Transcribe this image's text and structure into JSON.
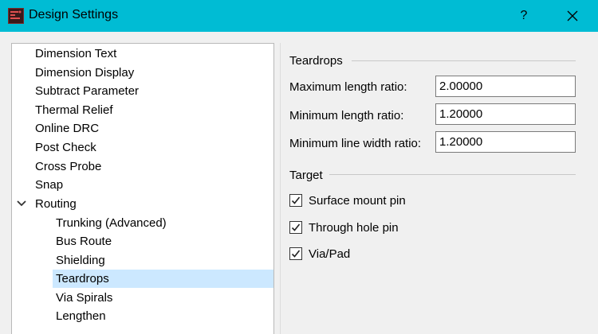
{
  "window": {
    "title": "Design Settings",
    "help_label": "?",
    "titlebar_color": "#00bcd4",
    "app_icon": "design-app-icon",
    "help_icon": "question-mark",
    "close_icon": "close-x"
  },
  "tree": {
    "items": [
      {
        "label": "Dimension Text",
        "level": 0
      },
      {
        "label": "Dimension Display",
        "level": 0
      },
      {
        "label": "Subtract Parameter",
        "level": 0
      },
      {
        "label": "Thermal Relief",
        "level": 0
      },
      {
        "label": "Online DRC",
        "level": 0
      },
      {
        "label": "Post Check",
        "level": 0
      },
      {
        "label": "Cross Probe",
        "level": 0
      },
      {
        "label": "Snap",
        "level": 0
      },
      {
        "label": "Routing",
        "level": 0,
        "expanded": true
      },
      {
        "label": "Trunking (Advanced)",
        "level": 1
      },
      {
        "label": "Bus Route",
        "level": 1
      },
      {
        "label": "Shielding",
        "level": 1
      },
      {
        "label": "Teardrops",
        "level": 1,
        "selected": true
      },
      {
        "label": "Via Spirals",
        "level": 1
      },
      {
        "label": "Lengthen",
        "level": 1
      }
    ],
    "selection_color": "#cce8ff"
  },
  "teardrops": {
    "section_title": "Teardrops",
    "max_length_label": "Maximum length ratio:",
    "max_length_value": "2.00000",
    "min_length_label": "Minimum length ratio:",
    "min_length_value": "1.20000",
    "min_line_width_label": "Minimum line width ratio:",
    "min_line_width_value": "1.20000"
  },
  "target": {
    "section_title": "Target",
    "options": [
      {
        "label": "Surface mount pin",
        "checked": true
      },
      {
        "label": "Through hole pin",
        "checked": true
      },
      {
        "label": "Via/Pad",
        "checked": true
      }
    ]
  }
}
